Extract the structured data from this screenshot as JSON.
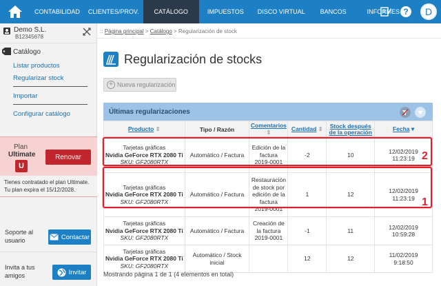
{
  "nav": {
    "items": [
      {
        "label": "CONTABILIDAD"
      },
      {
        "label": "CLIENTES/PROV."
      },
      {
        "label": "CATÁLOGO"
      },
      {
        "label": "IMPUESTOS"
      },
      {
        "label": "DISCO VIRTUAL"
      },
      {
        "label": "BANCOS"
      },
      {
        "label": "INFORMES"
      }
    ],
    "avatar_letter": "D"
  },
  "sidebar": {
    "company_name": "Demo S.L.",
    "company_id": "B12345678",
    "section_title": "Catálogo",
    "links": {
      "list": "Listar productos",
      "regularize": "Regularizar stock",
      "import": "Importar",
      "configure": "Configurar catálogo"
    },
    "plan": {
      "label": "Plan",
      "name": "Ultimate",
      "badge": "U",
      "renew": "Renovar",
      "note_line1": "Tienes contratado el plan Ultimate.",
      "note_line2": "Tu plan expira el 15/12/2028."
    },
    "support": {
      "line1": "Soporte al",
      "line2": "usuario",
      "button": "Contactar"
    },
    "invite": {
      "line1": "Invita a tus",
      "line2": "amigos",
      "button": "Invitar"
    }
  },
  "breadcrumb": {
    "prefix": "::",
    "home": "Página principal",
    "catalog": "Catálogo",
    "current": "Regularización de stock"
  },
  "page": {
    "title": "Regularización de stocks",
    "new_button": "Nueva regularización"
  },
  "panel": {
    "title": "Últimas regularizaciones",
    "columns": {
      "product": "Producto",
      "type": "Tipo / Razón",
      "comments": "Comentarios",
      "quantity": "Cantidad",
      "stock_after_1": "Stock después",
      "stock_after_2": "de la operación",
      "date": "Fecha"
    },
    "rows": [
      {
        "p1": "Tarjetas gráficas",
        "p2": "Nvidia GeForce RTX 2080 Ti",
        "sku": "SKU: GF2080RTX",
        "type1": "Automático / Factura",
        "type2": "",
        "c1": "Edición de la",
        "c2": "factura",
        "c3": "2019-0001",
        "c4": "",
        "qty": "-2",
        "stock": "10",
        "date": "12/02/2019",
        "time": "11:23:19"
      },
      {
        "p1": "Tarjetas gráficas",
        "p2": "Nvidia GeForce RTX 2080 Ti",
        "sku": "SKU: GF2080RTX",
        "type1": "Automático / Factura",
        "type2": "",
        "c1": "Restauración",
        "c2": "de stock por",
        "c3": "edición de la",
        "c4": "factura",
        "c5": "2019-0001",
        "qty": "1",
        "stock": "12",
        "date": "12/02/2019",
        "time": "11:23:19"
      },
      {
        "p1": "Tarjetas gráficas",
        "p2": "Nvidia GeForce RTX 2080 Ti",
        "sku": "SKU: GF2080RTX",
        "type1": "Automático / Factura",
        "type2": "",
        "c1": "Creación de",
        "c2": "la factura",
        "c3": "2019-0001",
        "c4": "",
        "qty": "-1",
        "stock": "11",
        "date": "12/02/2019",
        "time": "10:59:28"
      },
      {
        "p1": "Tarjetas gráficas",
        "p2": "Nvidia GeForce RTX 2080 Ti",
        "sku": "SKU: GF2080RTX",
        "type1": "Automático / Stock",
        "type2": "inicial",
        "c1": "",
        "c2": "",
        "c3": "",
        "c4": "",
        "qty": "12",
        "stock": "12",
        "date": "11/02/2019",
        "time": "9:18:50"
      }
    ],
    "footer": "Mostrando página 1 de 1 (4 elementos en total)"
  },
  "annotations": {
    "label_a": "2",
    "label_b": "1"
  },
  "colors": {
    "nav_blue": "#1d7fc4",
    "nav_active": "#2a3a4a",
    "renew_red": "#c0272d",
    "highlight_red": "#e0202a",
    "panel_blue": "#9cc3e6"
  }
}
